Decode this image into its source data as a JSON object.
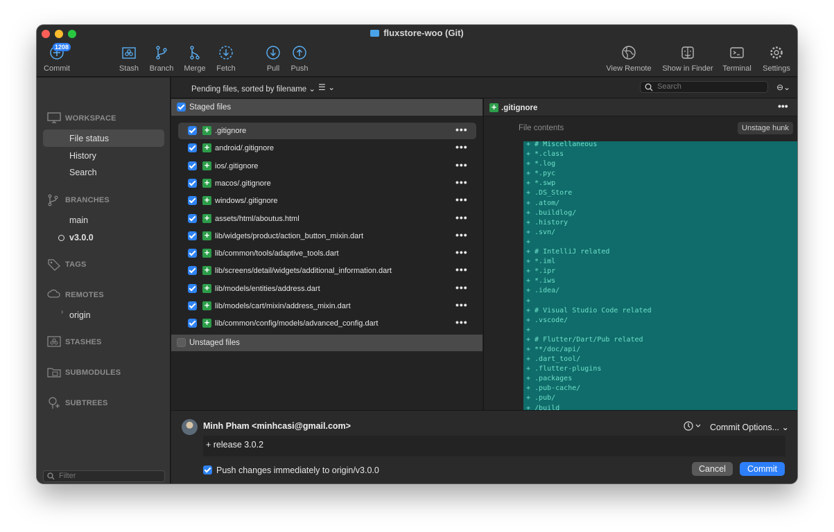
{
  "window": {
    "title": "fluxstore-woo (Git)"
  },
  "toolbar": {
    "commit_badge": "1208",
    "left": [
      {
        "label": "Commit",
        "icon": "commit-plus-icon"
      },
      {
        "label": "Stash",
        "icon": "stash-icon"
      },
      {
        "label": "Branch",
        "icon": "branch-icon"
      },
      {
        "label": "Merge",
        "icon": "merge-icon"
      },
      {
        "label": "Fetch",
        "icon": "fetch-icon"
      },
      {
        "label": "Pull",
        "icon": "pull-icon"
      },
      {
        "label": "Push",
        "icon": "push-icon"
      }
    ],
    "right": [
      {
        "label": "View Remote",
        "icon": "globe-icon"
      },
      {
        "label": "Show in Finder",
        "icon": "finder-icon"
      },
      {
        "label": "Terminal",
        "icon": "terminal-icon"
      },
      {
        "label": "Settings",
        "icon": "gear-icon"
      }
    ]
  },
  "sidebar": {
    "workspace": "WORKSPACE",
    "workspace_items": [
      "File status",
      "History",
      "Search"
    ],
    "branches": "BRANCHES",
    "branch_items": [
      "main",
      "v3.0.0"
    ],
    "tags": "TAGS",
    "remotes": "REMOTES",
    "remote_items": [
      "origin"
    ],
    "stashes": "STASHES",
    "submodules": "SUBMODULES",
    "subtrees": "SUBTREES",
    "filter_placeholder": "Filter"
  },
  "list": {
    "sort_label": "Pending files, sorted by filename",
    "search_placeholder": "Search",
    "staged_label": "Staged files",
    "unstaged_label": "Unstaged files",
    "staged_files": [
      ".gitignore",
      "android/.gitignore",
      "ios/.gitignore",
      "macos/.gitignore",
      "windows/.gitignore",
      "assets/html/aboutus.html",
      "lib/widgets/product/action_button_mixin.dart",
      "lib/common/tools/adaptive_tools.dart",
      "lib/screens/detail/widgets/additional_information.dart",
      "lib/models/entities/address.dart",
      "lib/models/cart/mixin/address_mixin.dart",
      "lib/common/config/models/advanced_config.dart"
    ]
  },
  "diff": {
    "file": ".gitignore",
    "hunk_header": "File contents",
    "unstage_label": "Unstage hunk",
    "lines": [
      "+ # Miscellaneous",
      "+ *.class",
      "+ *.log",
      "+ *.pyc",
      "+ *.swp",
      "+ .DS_Store",
      "+ .atom/",
      "+ .buildlog/",
      "+ .history",
      "+ .svn/",
      "+",
      "+ # IntelliJ related",
      "+ *.iml",
      "+ *.ipr",
      "+ *.iws",
      "+ .idea/",
      "+",
      "+ # Visual Studio Code related",
      "+ .vscode/",
      "+",
      "+ # Flutter/Dart/Pub related",
      "+ **/doc/api/",
      "+ .dart_tool/",
      "+ .flutter-plugins",
      "+ .packages",
      "+ .pub-cache/",
      "+ .pub/",
      "+ /build"
    ]
  },
  "commit": {
    "author": "Minh Pham <minhcasi@gmail.com>",
    "message": "+ release 3.0.2",
    "push_label": "Push changes immediately to origin/v3.0.0",
    "options_label": "Commit Options...",
    "cancel_label": "Cancel",
    "commit_label": "Commit"
  },
  "colors": {
    "accent": "#2d7ff9",
    "added": "#2d9d4a",
    "diff_bg": "#0f6c6a",
    "diff_text": "#6fe0ca"
  }
}
